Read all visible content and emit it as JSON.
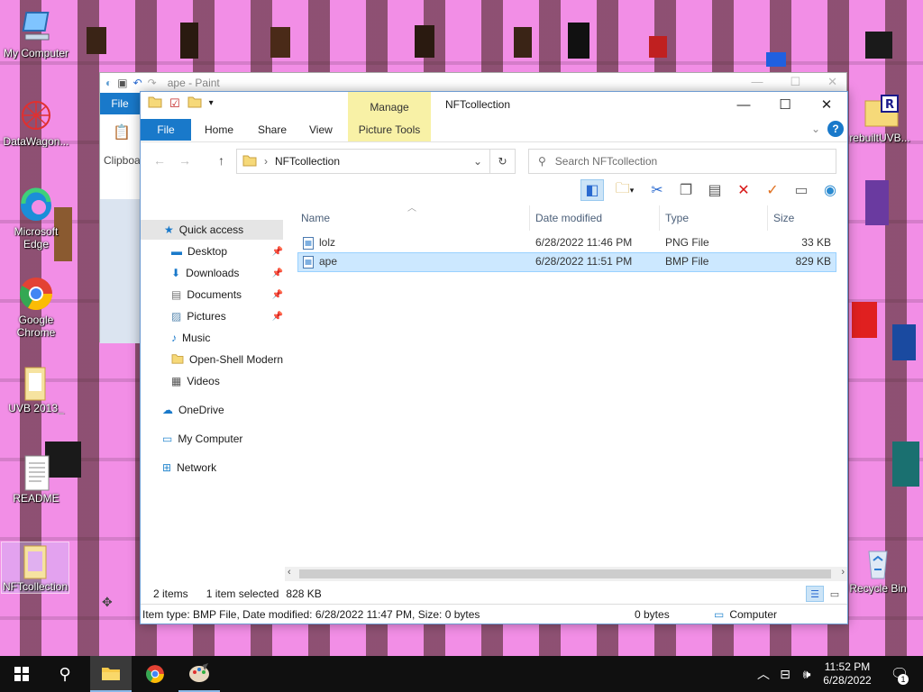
{
  "desktop": {
    "icons": [
      {
        "label": "My Computer"
      },
      {
        "label": "DataWagon..."
      },
      {
        "label": "Microsoft Edge"
      },
      {
        "label": "Google Chrome"
      },
      {
        "label": "UVB 2013_"
      },
      {
        "label": "README"
      },
      {
        "label": "NFTcollection"
      },
      {
        "label": "rebuiltUVB..."
      },
      {
        "label": "Recycle Bin"
      }
    ]
  },
  "paint": {
    "title": "ape - Paint",
    "file_tab": "File",
    "clipboard_label": "Clipboa"
  },
  "explorer": {
    "title": "NFTcollection",
    "manage_tab": "Manage",
    "picture_tools": "Picture Tools",
    "ribbon_tabs": {
      "file": "File",
      "home": "Home",
      "share": "Share",
      "view": "View"
    },
    "address": "NFTcollection",
    "search_placeholder": "Search NFTcollection",
    "nav": {
      "quick_access": "Quick access",
      "desktop": "Desktop",
      "downloads": "Downloads",
      "documents": "Documents",
      "pictures": "Pictures",
      "music": "Music",
      "open_shell": "Open-Shell Modern",
      "videos": "Videos",
      "onedrive": "OneDrive",
      "my_computer": "My Computer",
      "network": "Network"
    },
    "columns": {
      "name": "Name",
      "date": "Date modified",
      "type": "Type",
      "size": "Size"
    },
    "files": [
      {
        "name": "lolz",
        "date": "6/28/2022 11:46 PM",
        "type": "PNG File",
        "size": "33 KB"
      },
      {
        "name": "ape",
        "date": "6/28/2022 11:51 PM",
        "type": "BMP File",
        "size": "829 KB"
      }
    ],
    "status": {
      "items": "2 items",
      "selected": "1 item selected",
      "size": "828 KB"
    },
    "details": {
      "info": "Item type: BMP File, Date modified: 6/28/2022 11:47 PM, Size: 0 bytes",
      "bytes": "0 bytes",
      "location": "Computer"
    }
  },
  "taskbar": {
    "time": "11:52 PM",
    "date": "6/28/2022",
    "notification_count": "1"
  },
  "colors": {
    "accent": "#1979ca",
    "manage": "#f8f1a6",
    "selection": "#cce8ff",
    "wallpaper": "#f28ee6"
  }
}
